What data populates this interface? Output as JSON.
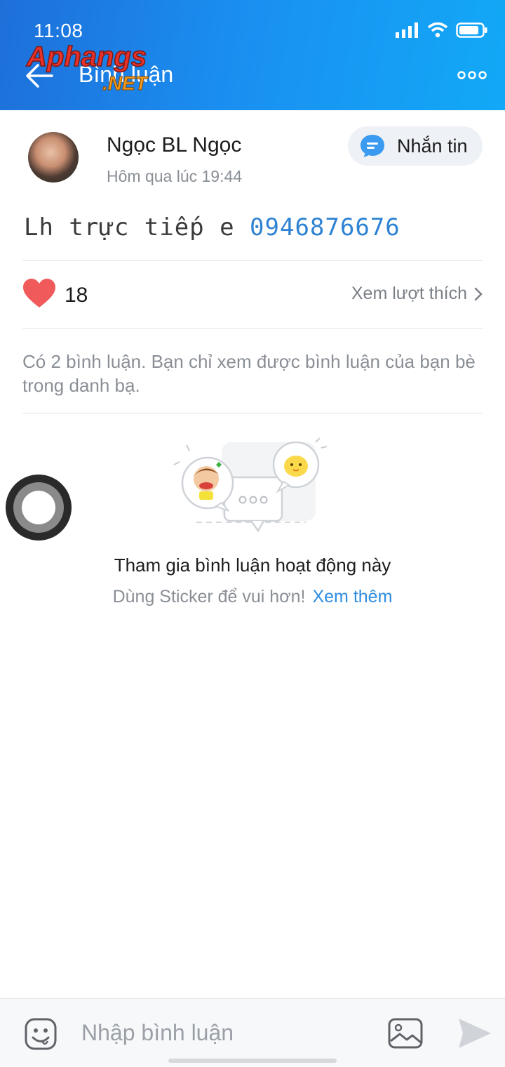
{
  "status_bar": {
    "time": "11:08"
  },
  "header": {
    "title": "Bình luận",
    "watermark_main": "Aphangs",
    "watermark_sub": ".NET"
  },
  "post": {
    "author_name": "Ngọc BL Ngọc",
    "time": "Hôm qua lúc 19:44",
    "message_button_label": "Nhắn tin",
    "text_prefix": "Lh trực tiếp e ",
    "phone": "0946876676"
  },
  "likes": {
    "count": "18",
    "view_label": "Xem lượt thích"
  },
  "comments": {
    "note": "Có 2 bình luận. Bạn chỉ xem được bình luận của bạn bè trong danh bạ."
  },
  "empty_state": {
    "title": "Tham gia bình luận hoạt động này",
    "subtitle": "Dùng Sticker để vui hơn!",
    "more_link": "Xem thêm"
  },
  "input": {
    "placeholder": "Nhập bình luận"
  },
  "colors": {
    "header_start": "#1e6fd9",
    "header_end": "#12a9f7",
    "accent": "#2d8ce0",
    "heart": "#f05a5a"
  },
  "icons": [
    "back-arrow-icon",
    "more-icon",
    "chat-bubble-icon",
    "heart-icon",
    "chevron-right-icon",
    "emoji-icon",
    "image-icon",
    "send-icon",
    "signal-icon",
    "wifi-icon",
    "battery-icon"
  ]
}
